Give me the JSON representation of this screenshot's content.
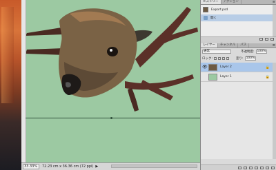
{
  "status": {
    "zoom": "33.33%",
    "doc_size": "72.23 cm x 36.36 cm (72 ppi)",
    "arrow": "▶"
  },
  "history": {
    "tabs": [
      "ヒストリー",
      "アクション"
    ],
    "items": [
      {
        "label": "Export.psd",
        "icon": "image-thumbnail"
      },
      {
        "label": "開く",
        "icon": "brush-icon"
      }
    ]
  },
  "layers": {
    "tabs": [
      "レイヤー",
      "チャンネル",
      "パス"
    ],
    "blend_mode": "通常",
    "opacity_label": "不透明度:",
    "opacity_value": "100%",
    "lock_label": "ロック:",
    "fill_label": "塗り:",
    "fill_value": "100%",
    "items": [
      {
        "name": "Layer 2",
        "selected": true,
        "visible": true
      },
      {
        "name": "Layer 1",
        "selected": false,
        "visible": false
      }
    ]
  },
  "colors": {
    "canvas_bg": "#9cc9a2",
    "selection": "#a9c6ea"
  }
}
